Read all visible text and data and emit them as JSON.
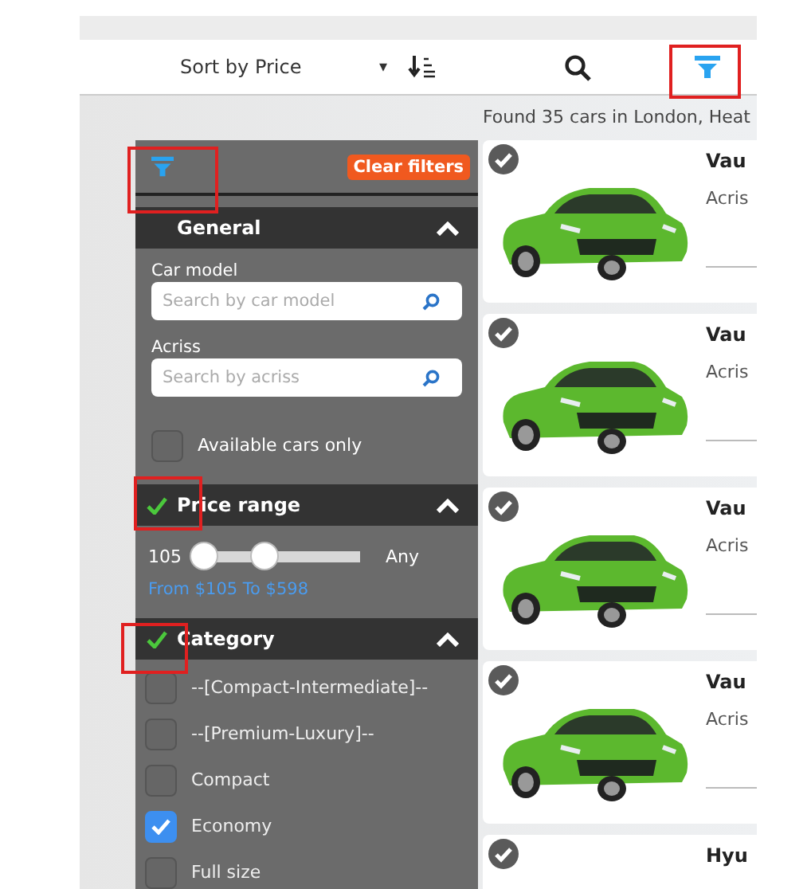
{
  "toolbar": {
    "sort_label": "Sort by Price",
    "sort_caret": "▾"
  },
  "results_summary": "Found 35 cars in London, Heat",
  "filters": {
    "clear_button": "Clear filters",
    "general": {
      "title": "General",
      "applied": false,
      "expanded": true,
      "fields": [
        {
          "label": "Car model",
          "placeholder": "Search by car model"
        },
        {
          "label": "Acriss",
          "placeholder": "Search by acriss"
        }
      ],
      "available_only": {
        "label": "Available cars only",
        "checked": false
      }
    },
    "price_range": {
      "title": "Price range",
      "applied": true,
      "expanded": true,
      "min_label": "105",
      "max_label": "Any",
      "thumbs": [
        {
          "level": 0
        },
        {
          "level": 0.42
        }
      ],
      "summary": "From $105 To $598"
    },
    "category": {
      "title": "Category",
      "applied": true,
      "expanded": true,
      "options": [
        {
          "label": "--[Compact-Intermediate]--",
          "checked": false
        },
        {
          "label": "--[Premium-Luxury]--",
          "checked": false
        },
        {
          "label": "Compact",
          "checked": false
        },
        {
          "label": "Economy",
          "checked": true
        },
        {
          "label": "Full size",
          "checked": false
        }
      ]
    }
  },
  "cars": [
    {
      "title": "Vau",
      "subtitle": "Acris"
    },
    {
      "title": "Vau",
      "subtitle": "Acris"
    },
    {
      "title": "Vau",
      "subtitle": "Acris"
    },
    {
      "title": "Vau",
      "subtitle": "Acris"
    },
    {
      "title": "Hyu"
    }
  ]
}
